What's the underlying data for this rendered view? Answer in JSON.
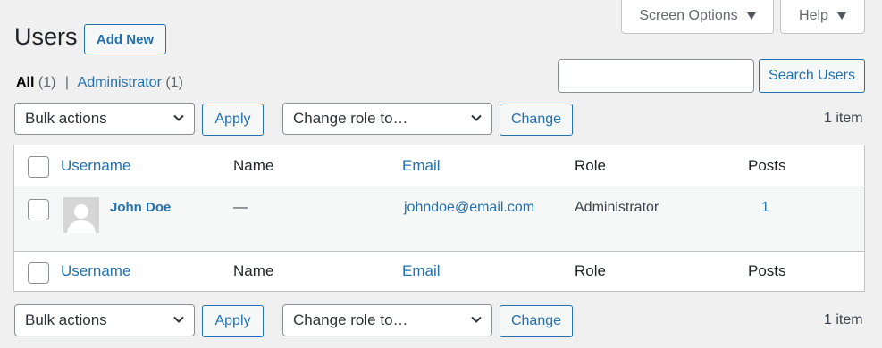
{
  "header": {
    "screen_options_label": "Screen Options",
    "help_label": "Help",
    "title": "Users",
    "add_new_label": "Add New"
  },
  "filters": {
    "all_label": "All",
    "all_count": "(1)",
    "separator": "|",
    "admin_label": "Administrator",
    "admin_count": "(1)"
  },
  "search": {
    "value": "",
    "button_label": "Search Users"
  },
  "top_nav": {
    "bulk_actions": "Bulk actions",
    "apply_label": "Apply",
    "change_role": "Change role to…",
    "change_label": "Change",
    "count": "1 item"
  },
  "bottom_nav": {
    "bulk_actions": "Bulk actions",
    "apply_label": "Apply",
    "change_role": "Change role to…",
    "change_label": "Change",
    "count": "1 item"
  },
  "table": {
    "columns": {
      "username": "Username",
      "name": "Name",
      "email": "Email",
      "role": "Role",
      "posts": "Posts"
    },
    "rows": [
      {
        "username": "John Doe",
        "name": "—",
        "email": "johndoe@email.com",
        "role": "Administrator",
        "posts": "1"
      }
    ]
  },
  "colors": {
    "accent": "#2271b1",
    "background": "#f0f0f1",
    "border": "#c3c4c7"
  }
}
